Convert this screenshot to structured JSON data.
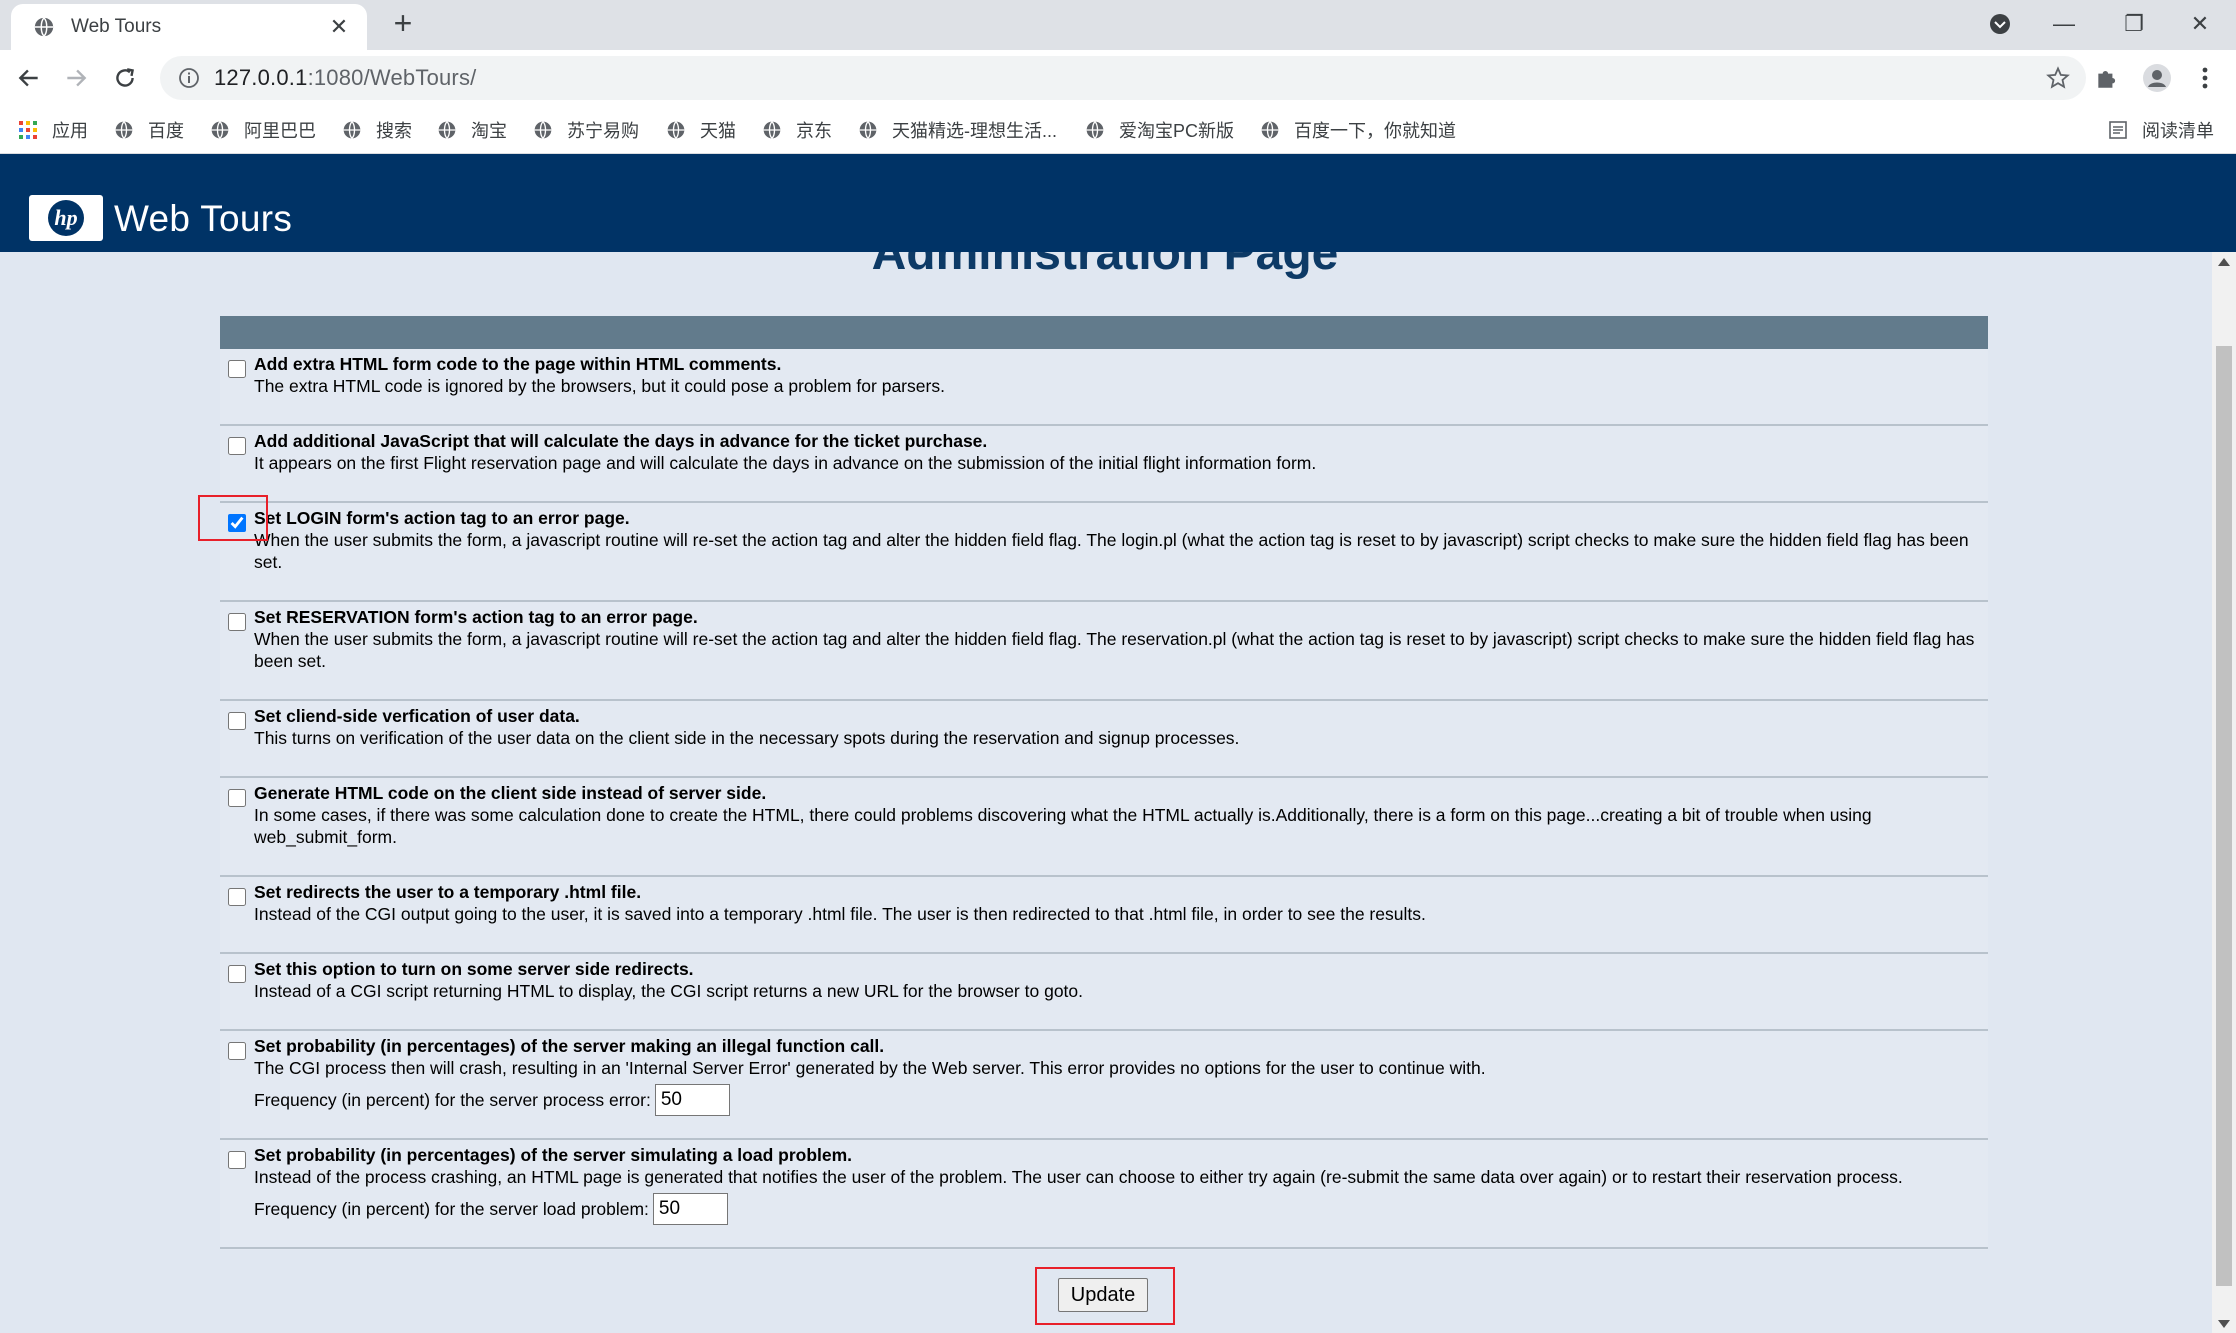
{
  "browser": {
    "tab_title": "Web Tours",
    "url_host": "127.0.0.1",
    "url_rest": ":1080/WebTours/",
    "bookmarks": [
      {
        "label": "应用",
        "icon": "apps-grid-icon"
      },
      {
        "label": "百度",
        "icon": "globe-icon"
      },
      {
        "label": "阿里巴巴",
        "icon": "globe-icon"
      },
      {
        "label": "搜索",
        "icon": "globe-icon"
      },
      {
        "label": "淘宝",
        "icon": "globe-icon"
      },
      {
        "label": "苏宁易购",
        "icon": "globe-icon"
      },
      {
        "label": "天猫",
        "icon": "globe-icon"
      },
      {
        "label": "京东",
        "icon": "globe-icon"
      },
      {
        "label": "天猫精选-理想生活...",
        "icon": "globe-icon"
      },
      {
        "label": "爱淘宝PC新版",
        "icon": "globe-icon"
      },
      {
        "label": "百度一下，你就知道",
        "icon": "globe-icon"
      }
    ],
    "reading_list": "阅读清单"
  },
  "site": {
    "logo_text": "hp",
    "title": "Web Tours",
    "page_title": "Administration Page"
  },
  "options": [
    {
      "title": "Add extra HTML form code to the page within HTML comments.",
      "description": "The extra HTML code is ignored by the browsers, but it could pose a problem for parsers.",
      "checked": false
    },
    {
      "title": "Add additional JavaScript that will calculate the days in advance for the ticket purchase.",
      "description": "It appears on the first Flight reservation page and will calculate the days in advance on the submission of the initial flight information form.",
      "checked": false
    },
    {
      "title": "Set LOGIN form's action tag to an error page.",
      "description": "When the user submits the form, a javascript routine will re-set the action tag and alter the hidden field flag. The login.pl (what the action tag is reset to by javascript) script checks to make sure the hidden field flag has been set.",
      "checked": true
    },
    {
      "title": "Set RESERVATION form's action tag to an error page.",
      "description": "When the user submits the form, a javascript routine will re-set the action tag and alter the hidden field flag. The reservation.pl (what the action tag is reset to by javascript) script checks to make sure the hidden field flag has been set.",
      "checked": false
    },
    {
      "title": "Set cliend-side verfication of user data.",
      "description": "This turns on verification of the user data on the client side in the necessary spots during the reservation and signup processes.",
      "checked": false
    },
    {
      "title": "Generate HTML code on the client side instead of server side.",
      "description": "In some cases, if there was some calculation done to create the HTML, there could problems discovering what the HTML actually is.Additionally, there is a form on this page...creating a bit of trouble when using web_submit_form.",
      "checked": false
    },
    {
      "title": "Set redirects the user to a temporary .html file.",
      "description": "Instead of the CGI output going to the user, it is saved into a temporary .html file. The user is then redirected to that .html file, in order to see the results.",
      "checked": false
    },
    {
      "title": "Set this option to turn on some server side redirects.",
      "description": "Instead of a CGI script returning HTML to display, the CGI script returns a new URL for the browser to goto.",
      "checked": false
    },
    {
      "title": "Set probability (in percentages) of the server making an illegal function call.",
      "description": "The CGI process then will crash, resulting in an 'Internal Server Error' generated by the Web server. This error provides no options for the user to continue with.",
      "checked": false,
      "freq_label": "Frequency (in percent) for the server process error:",
      "freq_value": "50"
    },
    {
      "title": "Set probability (in percentages) of the server simulating a load problem.",
      "description": "Instead of the process crashing, an HTML page is generated that notifies the user of the problem. The user can choose to either try again (re-submit the same data over again) or to restart their reservation process.",
      "checked": false,
      "freq_label": "Frequency (in percent) for the server load problem:",
      "freq_value": "50"
    }
  ],
  "update_label": "Update",
  "colors": {
    "header": "#003366",
    "page_bg": "#e0e7f1",
    "panel_head": "#627b8c",
    "title": "#0d3a66",
    "highlight": "#e8202a"
  }
}
